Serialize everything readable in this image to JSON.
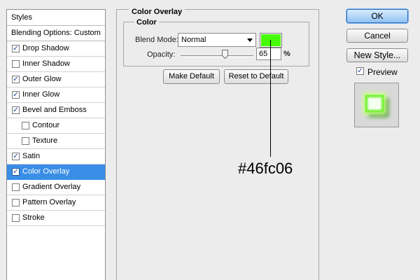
{
  "styles_panel": {
    "header": "Styles",
    "blending_options": "Blending Options: Custom",
    "items": [
      {
        "label": "Drop Shadow",
        "checked": true
      },
      {
        "label": "Inner Shadow",
        "checked": false
      },
      {
        "label": "Outer Glow",
        "checked": true
      },
      {
        "label": "Inner Glow",
        "checked": true
      },
      {
        "label": "Bevel and Emboss",
        "checked": true
      },
      {
        "label": "Contour",
        "checked": false
      },
      {
        "label": "Texture",
        "checked": false
      },
      {
        "label": "Satin",
        "checked": true
      },
      {
        "label": "Color Overlay",
        "checked": true,
        "selected": true
      },
      {
        "label": "Gradient Overlay",
        "checked": false
      },
      {
        "label": "Pattern Overlay",
        "checked": false
      },
      {
        "label": "Stroke",
        "checked": false
      }
    ]
  },
  "color_overlay": {
    "section_title": "Color Overlay",
    "group_title": "Color",
    "blend_mode_label": "Blend Mode:",
    "blend_mode_value": "Normal",
    "overlay_color": "#46fc06",
    "opacity_label": "Opacity:",
    "opacity_value": "65",
    "opacity_unit": "%",
    "opacity_slider_fraction": 0.65,
    "make_default": "Make Default",
    "reset_to_default": "Reset to Default"
  },
  "annotation": {
    "text": "#46fc06"
  },
  "right_panel": {
    "ok": "OK",
    "cancel": "Cancel",
    "new_style": "New Style...",
    "preview_label": "Preview",
    "preview_checked": true
  },
  "colors": {
    "selection": "#3a8ee6",
    "overlay": "#46fc06"
  }
}
